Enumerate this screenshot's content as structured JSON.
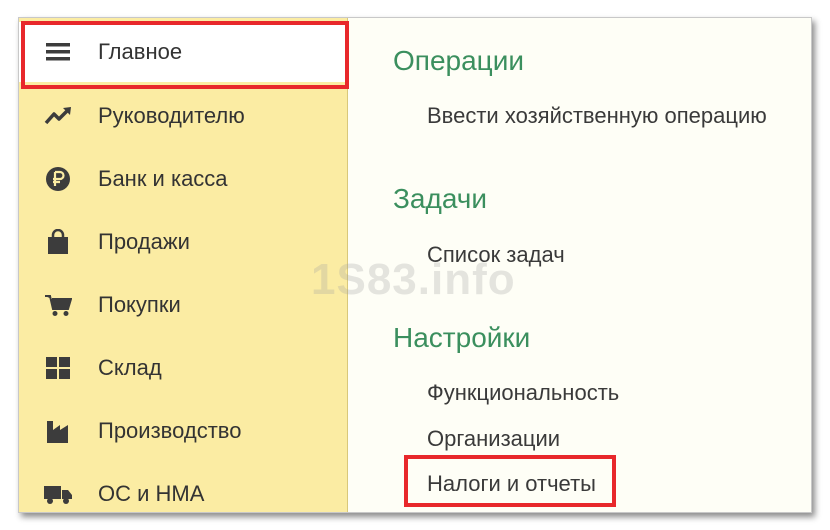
{
  "sidebar": {
    "items": [
      {
        "label": "Главное",
        "icon": "hamburger-menu-icon"
      },
      {
        "label": "Руководителю",
        "icon": "trend-chart-icon"
      },
      {
        "label": "Банк и касса",
        "icon": "ruble-coin-icon"
      },
      {
        "label": "Продажи",
        "icon": "shopping-bag-icon"
      },
      {
        "label": "Покупки",
        "icon": "shopping-cart-icon"
      },
      {
        "label": "Склад",
        "icon": "warehouse-grid-icon"
      },
      {
        "label": "Производство",
        "icon": "factory-icon"
      },
      {
        "label": "ОС и НМА",
        "icon": "truck-icon"
      }
    ]
  },
  "main": {
    "sections": [
      {
        "title": "Операции",
        "links": [
          "Ввести хозяйственную операцию"
        ]
      },
      {
        "title": "Задачи",
        "links": [
          "Список задач"
        ]
      },
      {
        "title": "Настройки",
        "links": [
          "Функциональность",
          "Организации",
          "Налоги и отчеты"
        ]
      }
    ]
  },
  "watermark": "1S83.info",
  "colors": {
    "sidebar_bg": "#fbeca3",
    "section_title": "#3b8f5e",
    "highlight": "#e8282b",
    "icon": "#3c3c3c"
  }
}
